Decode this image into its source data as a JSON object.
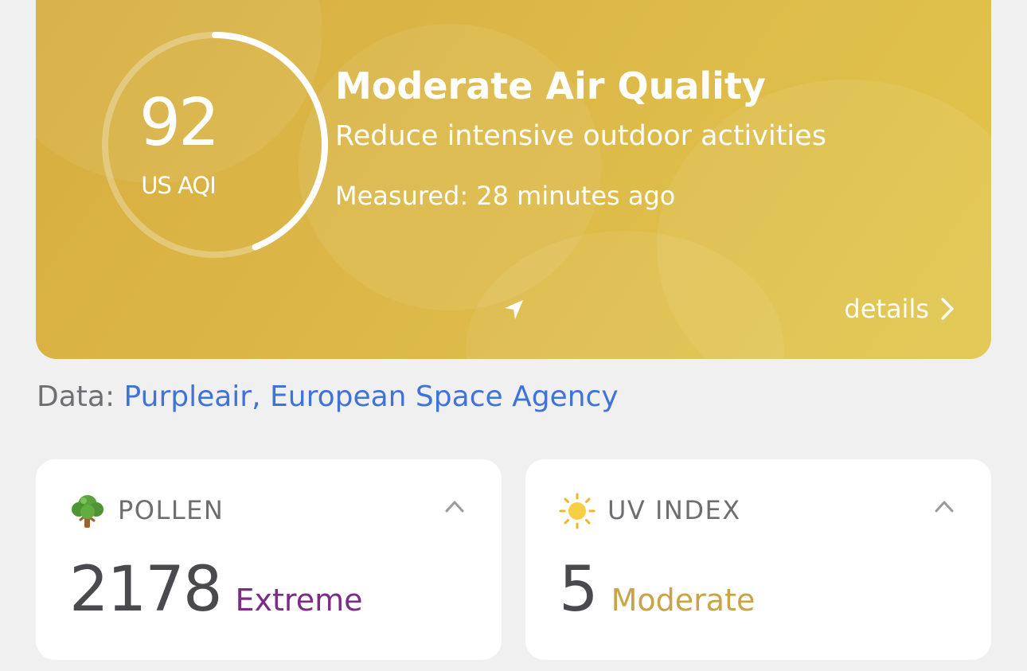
{
  "aqi": {
    "value": "92",
    "unit": "US AQI",
    "level_fraction": 0.44,
    "title": "Moderate Air Quality",
    "advice": "Reduce intensive outdoor activities",
    "measured": "Measured: 28 minutes ago",
    "details_label": "details",
    "card_color": "#dcb848",
    "location_icon": "location-arrow-icon",
    "details_icon": "chevron-right-icon"
  },
  "source": {
    "prefix": "Data:",
    "links": [
      "Purpleair,",
      "European Space Agency"
    ],
    "link_color": "#3f73d8"
  },
  "tiles": [
    {
      "icon": "tree-icon",
      "title": "POLLEN",
      "value": "2178",
      "level": "Extreme",
      "level_color": "#7b2d86",
      "toggle_icon": "chevron-up-icon"
    },
    {
      "icon": "sun-icon",
      "title": "UV INDEX",
      "value": "5",
      "level": "Moderate",
      "level_color": "#c9a348",
      "toggle_icon": "chevron-up-icon"
    }
  ]
}
